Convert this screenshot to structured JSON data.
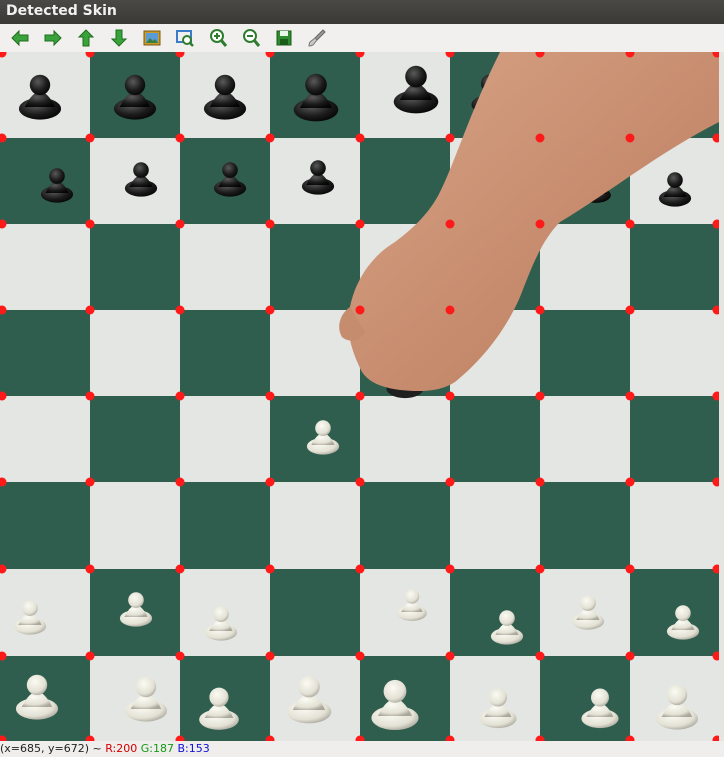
{
  "window": {
    "title": "Detected Skin"
  },
  "toolbar": {
    "buttons": [
      {
        "name": "pan-left-button",
        "icon": "arrow-left-icon",
        "color": "#3aa23a"
      },
      {
        "name": "pan-right-button",
        "icon": "arrow-right-icon",
        "color": "#3aa23a"
      },
      {
        "name": "pan-up-button",
        "icon": "arrow-up-icon",
        "color": "#3aa23a"
      },
      {
        "name": "pan-down-button",
        "icon": "arrow-down-icon",
        "color": "#3aa23a"
      },
      {
        "name": "zoom-fit-button",
        "icon": "image-icon",
        "color": "#c89b2e"
      },
      {
        "name": "zoom-region-button",
        "icon": "zoom-region-icon",
        "color": "#3b7cc8"
      },
      {
        "name": "zoom-in-button",
        "icon": "zoom-in-icon",
        "color": "#2e7d2e"
      },
      {
        "name": "zoom-out-button",
        "icon": "zoom-out-icon",
        "color": "#2e7d2e"
      },
      {
        "name": "save-button",
        "icon": "save-icon",
        "color": "#2e8b2e"
      },
      {
        "name": "properties-button",
        "icon": "brush-icon",
        "color": "#888888"
      }
    ]
  },
  "image": {
    "description_colors": {
      "light_square": "#e4e7e4",
      "dark_square": "#2f5e4f",
      "grid_dot": "#ff0000",
      "skin": "#c98f72"
    }
  },
  "status": {
    "coords": "(x=685, y=672) ~",
    "r": "R:200",
    "g": "G:187",
    "b": "B:153"
  }
}
